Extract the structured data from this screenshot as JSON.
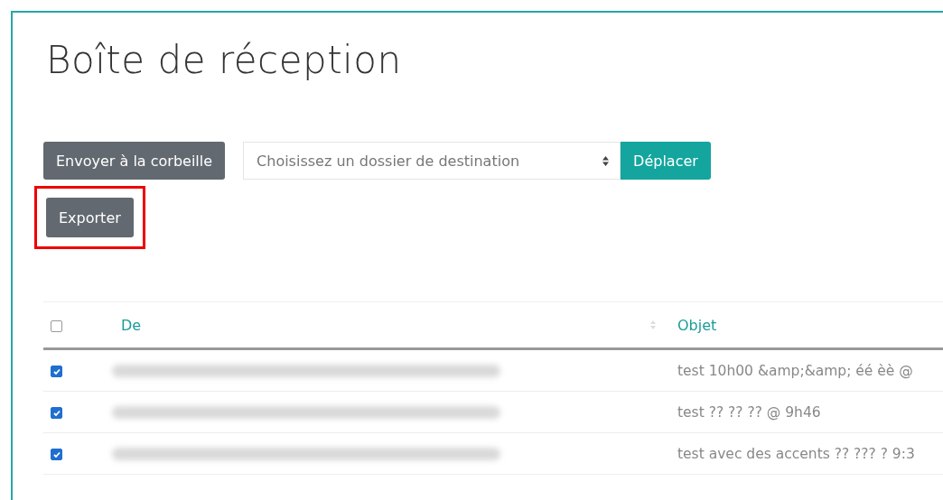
{
  "title": "Boîte de réception",
  "toolbar": {
    "trash_button": "Envoyer à la corbeille",
    "folder_select": {
      "placeholder": "Choisissez un dossier de destination"
    },
    "move_button": "Déplacer"
  },
  "export_button": {
    "label": "Exporter",
    "highlighted": true
  },
  "table": {
    "select_all": {
      "checked": false
    },
    "columns": [
      "De",
      "Objet"
    ],
    "rows": [
      {
        "checked": true,
        "subject": "test 10h00 &amp;&amp; éé èè @"
      },
      {
        "checked": true,
        "subject": "test ?? ?? ?? @ 9h46"
      },
      {
        "checked": true,
        "subject": "test avec des accents ?? ??? ? 9:3"
      }
    ]
  }
}
